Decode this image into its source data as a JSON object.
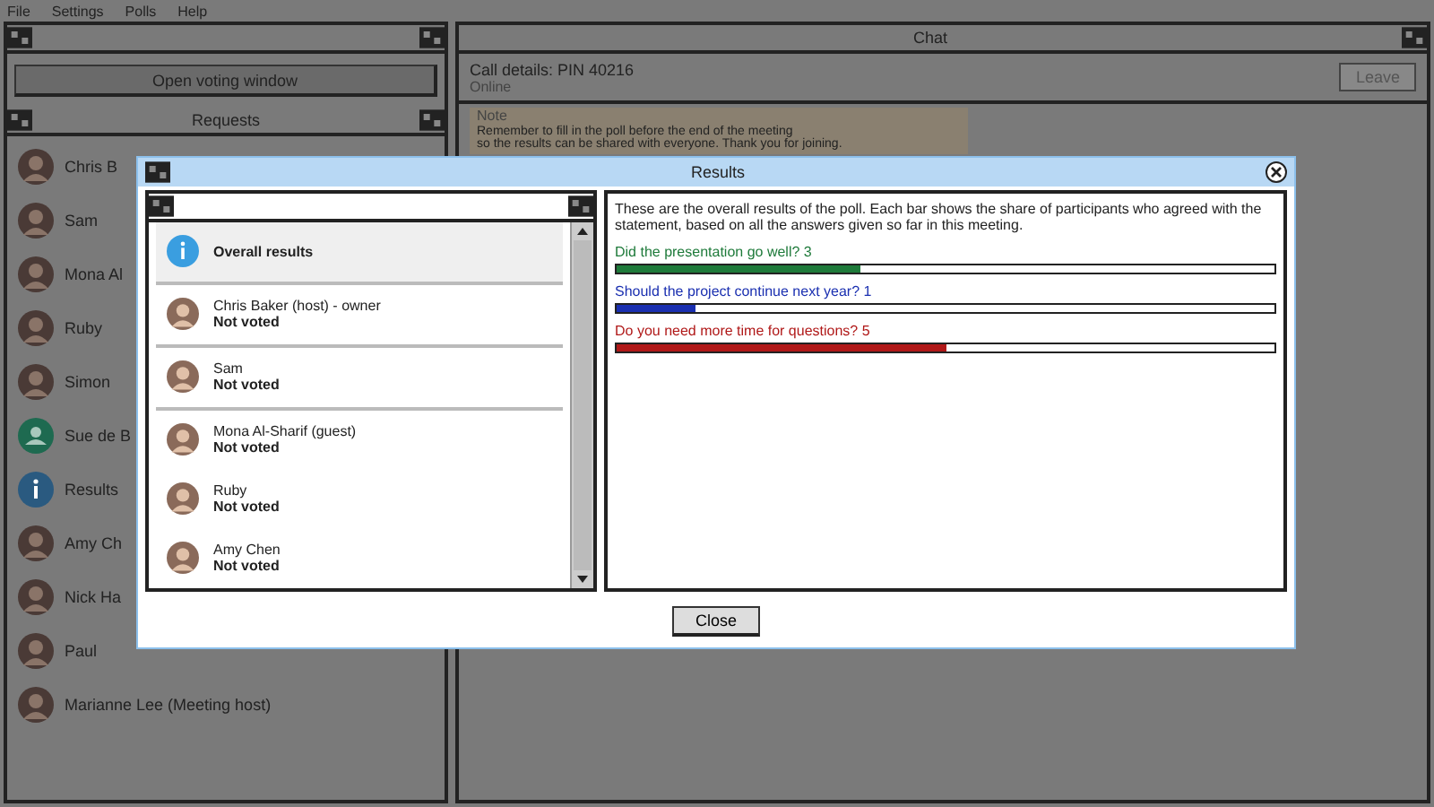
{
  "menu": [
    "File",
    "Settings",
    "Polls",
    "Help"
  ],
  "left_panel": {
    "button": "Open voting window",
    "list_title": "Requests",
    "items": [
      {
        "kind": "person",
        "name": "Chris B"
      },
      {
        "kind": "person",
        "name": "Sam"
      },
      {
        "kind": "person",
        "name": "Mona Al"
      },
      {
        "kind": "person",
        "name": "Ruby"
      },
      {
        "kind": "person",
        "name": "Simon"
      },
      {
        "kind": "group",
        "name": "Sue de B"
      },
      {
        "kind": "info",
        "name": "Results"
      },
      {
        "kind": "person",
        "name": "Amy Ch"
      },
      {
        "kind": "person",
        "name": "Nick Ha"
      },
      {
        "kind": "person",
        "name": "Paul"
      },
      {
        "kind": "person",
        "name": "Marianne Lee (Meeting host)"
      }
    ]
  },
  "right_panel": {
    "title": "Chat",
    "call": "Call details: PIN 40216",
    "call_status": "Online",
    "leave_button": "Leave",
    "note_title": "Note",
    "note_lines": [
      "Remember to fill in the poll before the end of the meeting",
      "so the results can be shared with everyone. Thank you for joining."
    ]
  },
  "dialog": {
    "title": "Results",
    "voters": [
      {
        "kind": "info",
        "name": "Overall results",
        "selected": true
      },
      {
        "kind": "person",
        "name": "Chris Baker (host) - owner",
        "status": "Not voted",
        "selected": false
      },
      {
        "kind": "person",
        "name": "Sam",
        "status": "Not voted",
        "selected": false
      },
      {
        "kind": "person",
        "name": "Mona Al-Sharif (guest)",
        "status": "Not voted",
        "selected": false
      },
      {
        "kind": "person",
        "name": "Ruby",
        "status": "Not voted",
        "selected": false
      },
      {
        "kind": "person",
        "name": "Amy Chen",
        "status": "Not voted",
        "selected": false
      }
    ],
    "intro": "These are the overall results of the poll. Each bar shows the share of participants who agreed with the statement, based on all the answers given so far in this meeting.",
    "questions": [
      {
        "text": "Did the presentation go well? 3",
        "color": "#1e7a3a",
        "level": 0.37
      },
      {
        "text": "Should the project continue next year? 1",
        "color": "#1a2fb0",
        "level": 0.12
      },
      {
        "text": "Do you need more time for questions? 5",
        "color": "#b01818",
        "level": 0.5
      }
    ],
    "close_button": "Close"
  }
}
